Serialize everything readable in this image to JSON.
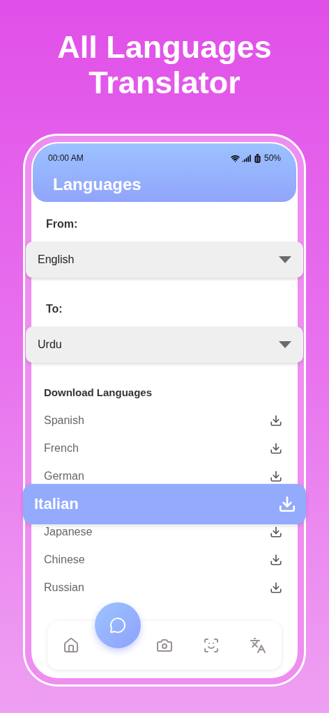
{
  "headline": {
    "lines": [
      "All Languages",
      "Translator"
    ]
  },
  "status_bar": {
    "time": "00:00 AM",
    "battery": "50%"
  },
  "header": {
    "title": "Languages"
  },
  "from": {
    "label": "From:",
    "value": "English"
  },
  "to": {
    "label": "To:",
    "value": "Urdu"
  },
  "downloads": {
    "title": "Download Languages",
    "languages": [
      {
        "name": "Spanish",
        "selected": false
      },
      {
        "name": "French",
        "selected": false
      },
      {
        "name": "German",
        "selected": false
      },
      {
        "name": "Italian",
        "selected": true
      },
      {
        "name": "Japanese",
        "selected": false
      },
      {
        "name": "Chinese",
        "selected": false
      },
      {
        "name": "Russian",
        "selected": false
      }
    ]
  },
  "nav": [
    {
      "kind": "home",
      "selected": false
    },
    {
      "kind": "history",
      "selected": true
    },
    {
      "kind": "camera",
      "selected": false
    },
    {
      "kind": "scan",
      "selected": false
    },
    {
      "kind": "translate",
      "selected": false
    }
  ]
}
